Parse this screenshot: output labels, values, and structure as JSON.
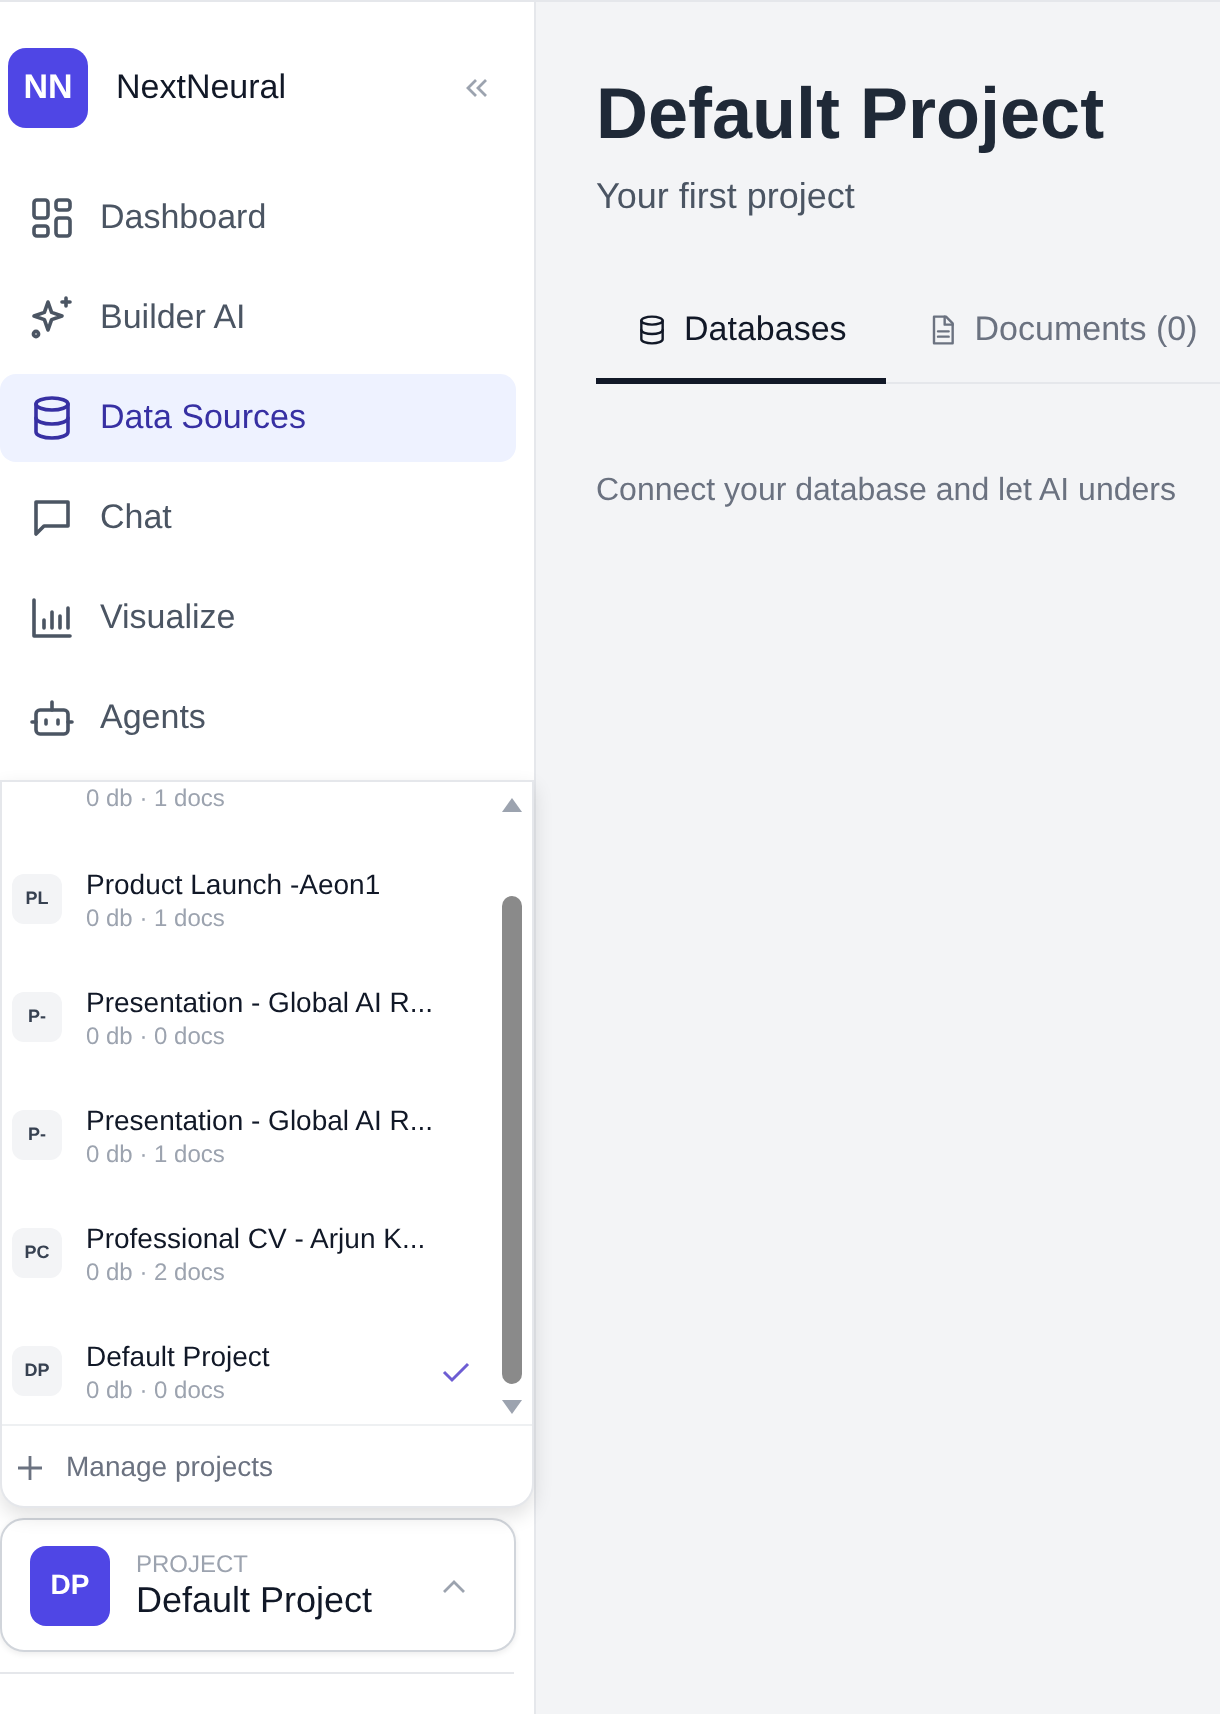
{
  "brand": {
    "initials": "NN",
    "name": "NextNeural"
  },
  "nav": [
    {
      "label": "Dashboard",
      "selected": false
    },
    {
      "label": "Builder AI",
      "selected": false
    },
    {
      "label": "Data Sources",
      "selected": true
    },
    {
      "label": "Chat",
      "selected": false
    },
    {
      "label": "Visualize",
      "selected": false
    },
    {
      "label": "Agents",
      "selected": false
    }
  ],
  "project_menu": {
    "items": [
      {
        "meta": "0 db · 1 docs",
        "selected": false
      },
      {
        "initials": "PL",
        "name": "Product Launch -Aeon1",
        "meta": "0 db · 1 docs",
        "selected": false
      },
      {
        "initials": "P-",
        "name": "Presentation - Global AI R...",
        "meta": "0 db · 0 docs",
        "selected": false
      },
      {
        "initials": "P-",
        "name": "Presentation - Global AI R...",
        "meta": "0 db · 1 docs",
        "selected": false
      },
      {
        "initials": "PC",
        "name": "Professional CV - Arjun K...",
        "meta": "0 db · 2 docs",
        "selected": false
      },
      {
        "initials": "DP",
        "name": "Default Project",
        "meta": "0 db · 0 docs",
        "selected": true
      }
    ],
    "manage": "Manage projects"
  },
  "project_switcher": {
    "initials": "DP",
    "caption": "PROJECT",
    "name": "Default Project"
  },
  "main": {
    "title": "Default Project",
    "subtitle": "Your first project",
    "tabs": [
      {
        "label": "Databases",
        "selected": true
      },
      {
        "label": "Documents (0)",
        "selected": false
      }
    ],
    "description": "Connect your database and let AI unders"
  }
}
